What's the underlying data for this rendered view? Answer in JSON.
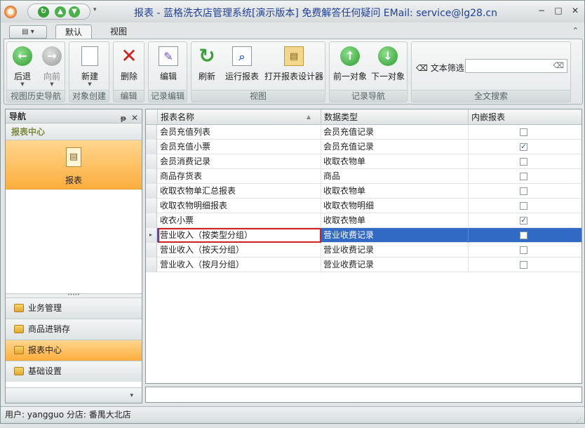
{
  "window": {
    "title": "报表 - 蓝格洗衣店管理系统[演示版本] 免费解答任何疑问 EMail: service@lg28.cn",
    "min_glyph": "−",
    "max_glyph": "□",
    "close_glyph": "✕"
  },
  "quick_access": {
    "more_glyph": "▾"
  },
  "ribbon": {
    "tabs": [
      {
        "label": "默认"
      },
      {
        "label": "视图"
      }
    ],
    "collapse_glyph": "⌃",
    "groups": {
      "history": {
        "caption": "视图历史导航",
        "back": "后退",
        "forward": "向前"
      },
      "create": {
        "caption": "对象创建",
        "new": "新建"
      },
      "delete": {
        "caption": "编辑",
        "delete": "删除"
      },
      "record_edit": {
        "caption": "记录编辑",
        "edit": "编辑"
      },
      "view": {
        "caption": "视图",
        "refresh": "刷新",
        "run_report": "运行报表",
        "open_designer": "打开报表设计器"
      },
      "record_nav": {
        "caption": "记录导航",
        "prev": "前一对象",
        "next": "下一对象"
      },
      "search": {
        "caption": "全文搜索",
        "filter_label": "文本筛选",
        "filter_value": ""
      }
    }
  },
  "nav": {
    "header": "导航",
    "pin_glyph": "ᵽ",
    "close_glyph": "✕",
    "section": "报表中心",
    "active_item": "报表",
    "splitter": "•••••",
    "groups": [
      {
        "label": "业务管理"
      },
      {
        "label": "商品进销存"
      },
      {
        "label": "报表中心"
      },
      {
        "label": "基础设置"
      }
    ],
    "bottom_glyph": "▾"
  },
  "grid": {
    "columns": [
      "报表名称",
      "数据类型",
      "内嵌报表"
    ],
    "sort_glyph": "▲",
    "rows": [
      {
        "name": "会员充值列表",
        "type": "会员充值记录",
        "embedded": false,
        "mark": ""
      },
      {
        "name": "会员充值小票",
        "type": "会员充值记录",
        "embedded": true,
        "mark": "✓"
      },
      {
        "name": "会员消费记录",
        "type": "收取衣物单",
        "embedded": false,
        "mark": ""
      },
      {
        "name": "商品存货表",
        "type": "商品",
        "embedded": false,
        "mark": ""
      },
      {
        "name": "收取衣物单汇总报表",
        "type": "收取衣物单",
        "embedded": false,
        "mark": ""
      },
      {
        "name": "收取衣物明细报表",
        "type": "收取衣物明细",
        "embedded": false,
        "mark": ""
      },
      {
        "name": "收衣小票",
        "type": "收取衣物单",
        "embedded": true,
        "mark": "✓"
      },
      {
        "name": "营业收入（按类型分组）",
        "type": "营业收费记录",
        "embedded": false,
        "mark": "",
        "selected": true
      },
      {
        "name": "营业收入（按天分组）",
        "type": "营业收费记录",
        "embedded": false,
        "mark": ""
      },
      {
        "name": "营业收入（按月分组）",
        "type": "营业收费记录",
        "embedded": false,
        "mark": ""
      }
    ]
  },
  "status": {
    "text": "用户: yangguo  分店: 番禺大北店",
    "grip": "⋰"
  }
}
